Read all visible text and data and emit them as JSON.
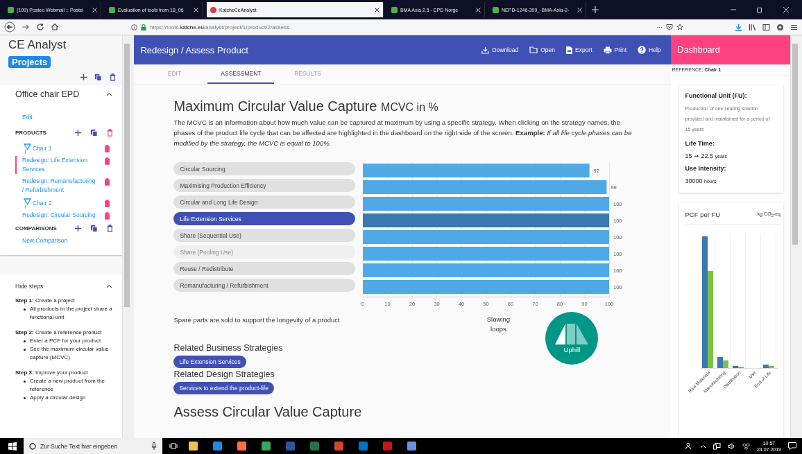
{
  "browser": {
    "tabs": [
      {
        "title": "(109) Posteo Webmail :: Postei",
        "selected": false
      },
      {
        "title": "Evaluation of tools from 18_06",
        "selected": false
      },
      {
        "title": "KatcheCeAnalyst",
        "selected": true
      },
      {
        "title": "BMA Axia 2.5 - EPD Norge",
        "selected": false
      },
      {
        "title": "NEPD-1246-399_-BMA-Axia-2-",
        "selected": false
      }
    ],
    "url": "https://tools.**katche.eu**/analyst/project/1/product/2/assess",
    "page_menu": "···"
  },
  "sidebar": {
    "app_title": "CE Analyst",
    "projects_button": "Projects",
    "project": {
      "name": "Office chair EPD",
      "expanded": true,
      "edit_link": "Edit",
      "products_label": "PRODUCTS",
      "products": [
        {
          "name": "Chair 1",
          "expanded": true,
          "children": [
            {
              "name": "Redesign: Life Extension Services",
              "selected": true
            },
            {
              "name": "Redesign: Remanufacturing / Refurbishment",
              "selected": false
            }
          ]
        },
        {
          "name": "Chair 2",
          "expanded": true,
          "children": [
            {
              "name": "Redesign: Circular Sourcing",
              "selected": false
            }
          ]
        }
      ],
      "comparisons_label": "COMPARISONS",
      "new_comparison": "New Comparison"
    },
    "steps": {
      "toggle": "Hide steps",
      "expanded": true,
      "items": [
        {
          "title": "**Step 1:** Create a project",
          "bullets": [
            "All products in the project share a functional unit"
          ]
        },
        {
          "title": "**Step 2:** Create a reference product",
          "bullets": [
            "Enter a PCF for your product",
            "See the maximum circular value capture (MCVC)"
          ]
        },
        {
          "title": "**Step 3:** Improve your product",
          "bullets": [
            "Create a new product from the reference",
            "Apply a circular design"
          ]
        }
      ]
    }
  },
  "header": {
    "title": "Redesign / Assess Product",
    "actions": [
      {
        "kind": "download",
        "label": "Download"
      },
      {
        "kind": "open",
        "label": "Open"
      },
      {
        "kind": "export",
        "label": "Export"
      },
      {
        "kind": "print",
        "label": "Print"
      },
      {
        "kind": "help",
        "label": "Help"
      }
    ]
  },
  "tabs": [
    {
      "label": "EDIT",
      "selected": false
    },
    {
      "label": "ASSESSMENT",
      "selected": true
    },
    {
      "label": "RESULTS",
      "selected": false
    }
  ],
  "content": {
    "heading": "Maximum Circular Value Capture",
    "heading_unit": "MCVC in %",
    "description": "The MCVC is an information about how much value can be captured at maximum by using a specific strategy. When clicking on the strategy names, the phases of the product life cycle that can be affected are highlighted in the dashboard on the right side of the screen. **Example:** *If all life cycle phases can be modified by the strategy, the MCVC is equal to 100%.*",
    "strategies": [
      {
        "label": "Circular Sourcing",
        "selected": false,
        "disabled": false
      },
      {
        "label": "Maximising Production Efficiency",
        "selected": false,
        "disabled": false
      },
      {
        "label": "Circular and Long Life Design",
        "selected": false,
        "disabled": false
      },
      {
        "label": "Life Extension Services",
        "selected": true,
        "disabled": false
      },
      {
        "label": "Share (Sequential Use)",
        "selected": false,
        "disabled": false
      },
      {
        "label": "Share (Pooling Use)",
        "selected": false,
        "disabled": true
      },
      {
        "label": "Reuse / Redistribute",
        "selected": false,
        "disabled": false
      },
      {
        "label": "Remanufacturing / Refurbishment",
        "selected": false,
        "disabled": false
      }
    ],
    "chart_data": {
      "type": "bar",
      "orientation": "horizontal",
      "values": [
        92,
        99,
        100,
        100,
        100,
        100,
        100,
        100
      ],
      "xlim": [
        0,
        100
      ],
      "grid": true,
      "xticks": [
        0,
        10,
        20,
        30,
        40,
        50,
        60,
        70,
        80,
        90,
        100
      ],
      "data_labels": true
    },
    "strategy_description": "Spare parts are sold to support the longevity of a product",
    "loop_type": "Slowing loops",
    "badge": "Uphill",
    "related_business": {
      "heading": "Related Business Strategies",
      "chips": [
        "Life Extension Services"
      ]
    },
    "related_design": {
      "heading": "Related Design Strategies",
      "chips": [
        "Services to extend the product-life"
      ]
    },
    "next_heading": "Assess Circular Value Capture"
  },
  "dashboard": {
    "title": "Dashboard",
    "reference_label": "REFERENCE:",
    "reference": "Chair 1",
    "fu_label": "Functional Unit (FU):",
    "fu_text": "Production of one seating solution provided and maintained for a period of 15 years",
    "life_label": "Life Time:",
    "life_value": "15 ➞ 22.5",
    "life_unit": "years",
    "use_label": "Use Intensity:",
    "use_value": "30000",
    "use_unit": "hours",
    "pcf_title": "PCF per FU",
    "pcf_unit": "kg CO$_{2}$-eq",
    "pcf_categories": [
      "Raw Materials",
      "Manufacturing",
      "Distribution",
      "Use",
      "End of Life"
    ]
  },
  "taskbar": {
    "search_placeholder": "Zur Suche Text hier eingeben",
    "time": "10:57",
    "date": "24.07.2019"
  }
}
